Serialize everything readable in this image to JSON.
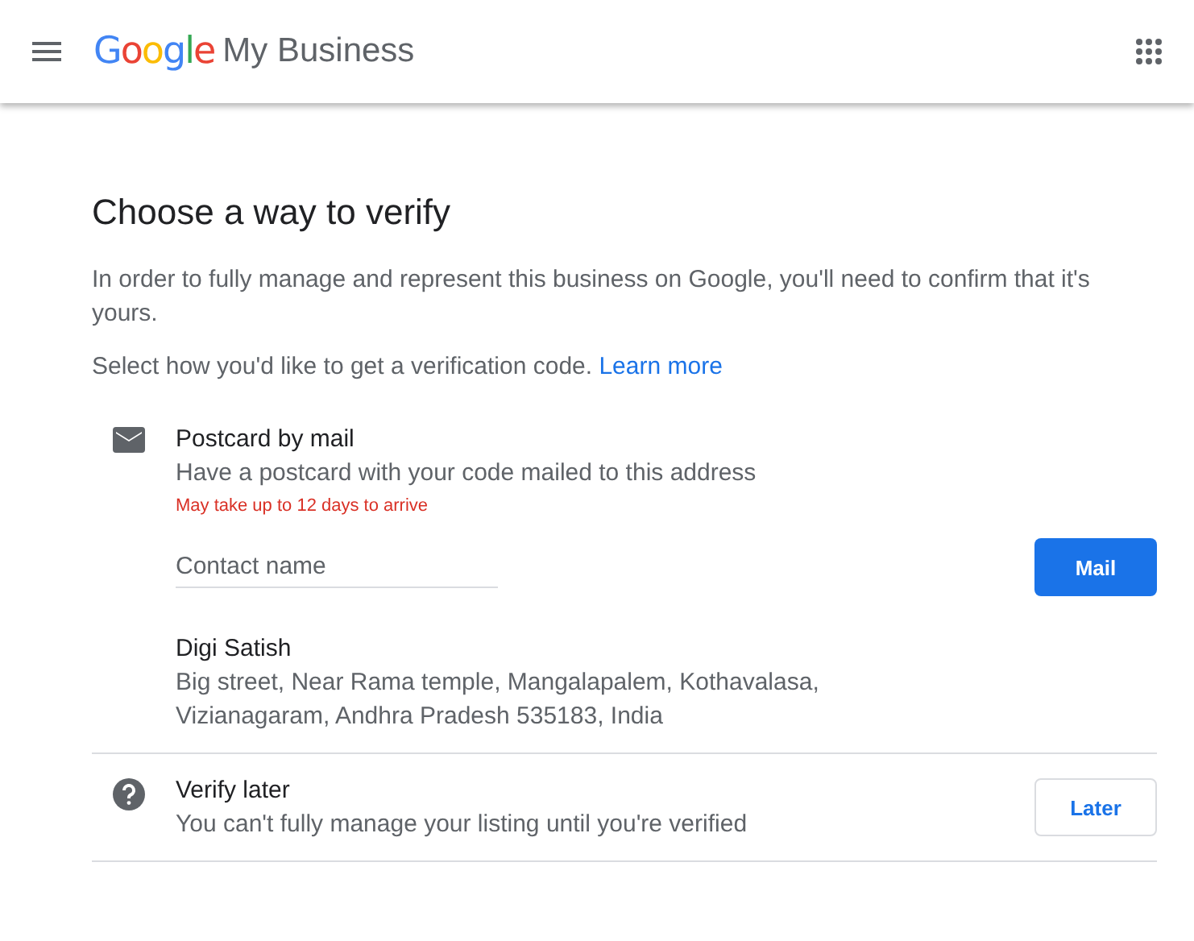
{
  "header": {
    "logo": "Google",
    "product": "My Business"
  },
  "page": {
    "title": "Choose a way to verify",
    "intro": "In order to fully manage and represent this business on Google, you'll need to confirm that it's yours.",
    "select_text": "Select how you'd like to get a verification code.",
    "learn_more": "Learn more"
  },
  "options": [
    {
      "kind": "mail",
      "title": "Postcard by mail",
      "description": "Have a postcard with your code mailed to this address",
      "note": "May take up to 12 days to arrive",
      "contact": {
        "placeholder": "Contact name"
      },
      "button": "Mail",
      "name": "Digi Satish",
      "address": [
        "Big street, Near Rama temple, Mangalapalem, Kothavalasa,",
        "Vizianagaram, Andhra Pradesh 535183, India"
      ]
    },
    {
      "kind": "later",
      "title": "Verify later",
      "description": "You can't fully manage your listing until you're verified",
      "button": "Later"
    }
  ]
}
